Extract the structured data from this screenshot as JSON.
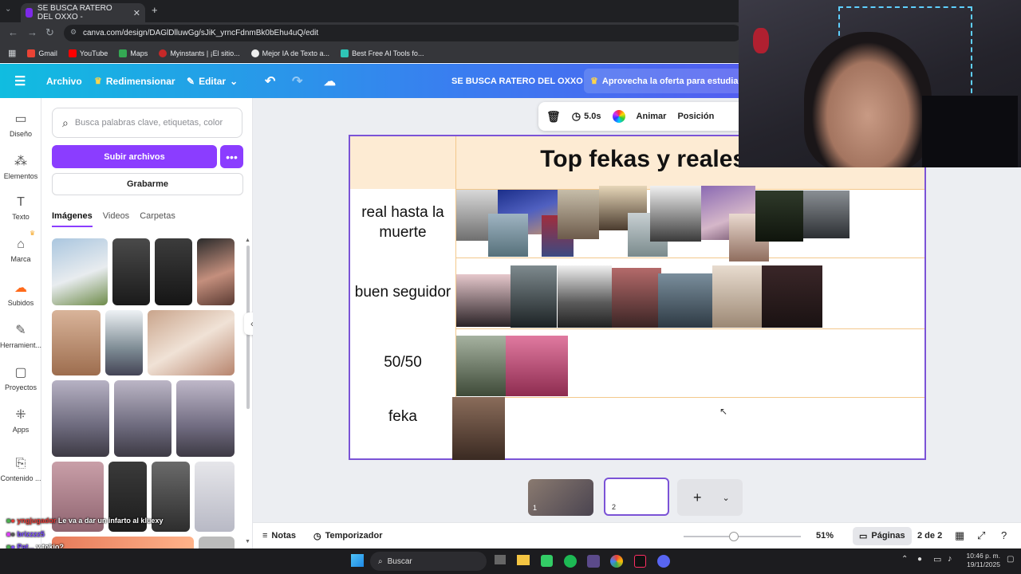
{
  "browser": {
    "tab_title": "SE BUSCA RATERO DEL OXXO -",
    "url": "canva.com/design/DAGlDlluwGg/sJiK_yrncFdnmBk0bEhu4uQ/edit",
    "bookmarks": [
      "Gmail",
      "YouTube",
      "Maps",
      "Myinstants | ¡El sitio...",
      "Mejor IA de Texto a...",
      "Best Free AI Tools fo..."
    ]
  },
  "header": {
    "archivo": "Archivo",
    "redimensionar": "Redimensionar",
    "editar": "Editar",
    "design_title": "SE BUSCA RATERO DEL OXXO",
    "promo": "Aprovecha la oferta para estudiant"
  },
  "rail": {
    "items": [
      "Diseño",
      "Elementos",
      "Texto",
      "Marca",
      "Subidos",
      "Herramient...",
      "Proyectos",
      "Apps",
      "Contenido ..."
    ]
  },
  "panel": {
    "search_placeholder": "Busca palabras clave, etiquetas, color",
    "upload_label": "Subir archivos",
    "more_label": "•••",
    "record_label": "Grabarme",
    "tabs": [
      "Imágenes",
      "Videos",
      "Carpetas"
    ]
  },
  "chat": [
    {
      "user": "yngjugador",
      "msg": "Le va a dar un infarto al kluexy"
    },
    {
      "user": "brizzzz5",
      "msg": ""
    },
    {
      "user": "Pat...",
      "msg": "y tokio?"
    }
  ],
  "toolbar": {
    "duration": "5.0s",
    "animar": "Animar",
    "posicion": "Posición"
  },
  "slide": {
    "title": "Top fekas y reales del chat",
    "rows": [
      "real hasta la muerte",
      "buen seguidor",
      "50/50",
      "feka"
    ]
  },
  "pages": {
    "page1_num": "1",
    "page2_num": "2",
    "add": "+"
  },
  "bottom": {
    "notas": "Notas",
    "temporizador": "Temporizador",
    "zoom": "51%",
    "zoom_fraction": 0.51,
    "paginas": "Páginas",
    "page_count": "2 de 2"
  },
  "taskbar": {
    "search": "Buscar",
    "time": "10:46 p. m.",
    "date": "19/11/2025"
  },
  "colors": {
    "accent": "#8b3dff",
    "header_start": "#10bde0",
    "header_end": "#6a3ff0",
    "title_bg": "#fdebd3",
    "row_line": "#f3c88c"
  }
}
